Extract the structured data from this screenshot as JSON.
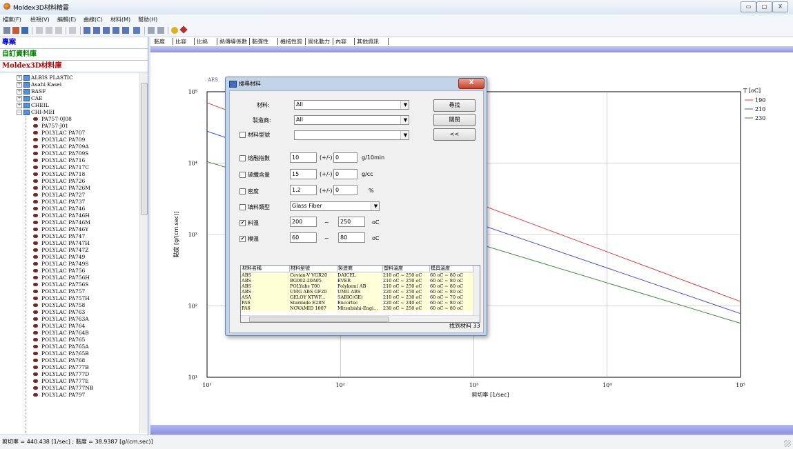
{
  "window": {
    "title": "Moldex3D材料精靈",
    "min": "▭",
    "max": "□",
    "close": "X"
  },
  "menu": [
    "檔案(F)",
    "檢視(V)",
    "編輯(E)",
    "曲線(C)",
    "材料(M)",
    "幫助(H)"
  ],
  "left_panel": {
    "headers": [
      "專案",
      "自訂資料庫",
      "Moldex3D材料庫"
    ],
    "header_colors": [
      "#0000c8",
      "#008000",
      "#c00000"
    ],
    "vendors": [
      "ALBIS PLASTIC",
      "Asahi Kasei",
      "BASF",
      "CAE",
      "CHEIL",
      "CHI-MEI"
    ],
    "materials": [
      "PA757-0J08",
      "PA757-J01",
      "POLYLAC PA707",
      "POLYLAC PA709",
      "POLYLAC PA709A",
      "POLYLAC PA709S",
      "POLYLAC PA716",
      "POLYLAC PA717C",
      "POLYLAC PA718",
      "POLYLAC PA726",
      "POLYLAC PA726M",
      "POLYLAC PA727",
      "POLYLAC PA737",
      "POLYLAC PA746",
      "POLYLAC PA746H",
      "POLYLAC PA746M",
      "POLYLAC PA746Y",
      "POLYLAC PA747",
      "POLYLAC PA747H",
      "POLYLAC PA747Z",
      "POLYLAC PA749",
      "POLYLAC PA749S",
      "POLYLAC PA756",
      "POLYLAC PA756H",
      "POLYLAC PA756S",
      "POLYLAC PA757",
      "POLYLAC PA757H",
      "POLYLAC PA758",
      "POLYLAC PA763",
      "POLYLAC PA763A",
      "POLYLAC PA764",
      "POLYLAC PA764B",
      "POLYLAC PA765",
      "POLYLAC PA765A",
      "POLYLAC PA765B",
      "POLYLAC PA768",
      "POLYLAC PA777B",
      "POLYLAC PA777D",
      "POLYLAC PA777E",
      "POLYLAC PA777NB",
      "POLYLAC PA797"
    ]
  },
  "tabs": [
    "黏度",
    "比容",
    "比熱",
    "熱傳導係數",
    "黏彈性",
    "機械性質",
    "固化動力",
    "內容",
    "其他資訊"
  ],
  "status_bar": "剪切率 = 440.438 [1/sec] ; 黏度 = 38.9387 [g/(cm.sec)]",
  "chart": {
    "hidden_label": "AES",
    "ylabel": "黏度 [g/(cm.sec)]",
    "xlabel": "剪切率 [1/sec]",
    "x_ticks": [
      "10¹",
      "10²",
      "10³",
      "10⁴",
      "10⁵"
    ],
    "y_ticks": [
      "10¹",
      "10²",
      "10³",
      "10⁴",
      "10⁵"
    ],
    "legend_title": "T [oC]"
  },
  "chart_data": {
    "type": "line",
    "x_scale": "log",
    "y_scale": "log",
    "xlim": [
      10,
      100000
    ],
    "ylim": [
      10,
      100000
    ],
    "xlabel": "剪切率 [1/sec]",
    "ylabel": "黏度 [g/(cm.sec)]",
    "legend_title": "T [oC]",
    "series": [
      {
        "name": "190",
        "color": "#d04040",
        "points": [
          [
            10,
            70000
          ],
          [
            100000,
            115
          ]
        ]
      },
      {
        "name": "210",
        "color": "#4050d0",
        "points": [
          [
            10,
            28000
          ],
          [
            100000,
            78
          ]
        ]
      },
      {
        "name": "230",
        "color": "#3a8a3a",
        "points": [
          [
            10,
            10500
          ],
          [
            100000,
            57
          ]
        ]
      }
    ]
  },
  "dialog": {
    "title": "搜尋材料",
    "close": "X",
    "fields": {
      "material_label": "材料:",
      "material_value": "All",
      "vendor_label": "製造商:",
      "vendor_value": "All",
      "grade_label": "材料型號",
      "grade_value": "",
      "melt_label": "熔融指數",
      "melt_value": "10",
      "melt_tol": "0",
      "melt_unit": "g/10min",
      "fiber_label": "玻纖含量",
      "fiber_value": "15",
      "fiber_tol": "0",
      "fiber_unit": "g/cc",
      "density_label": "密度",
      "density_value": "1.2",
      "density_tol": "0",
      "density_unit": "%",
      "filler_label": "填料類型",
      "filler_value": "Glass Fiber",
      "melt_temp_label": "料溫",
      "melt_temp_from": "200",
      "melt_temp_to": "250",
      "melt_temp_unit": "oC",
      "mold_temp_label": "模溫",
      "mold_temp_from": "60",
      "mold_temp_to": "80",
      "mold_temp_unit": "oC",
      "pm": "(+/-)",
      "dash": "~"
    },
    "checks": {
      "grade": false,
      "melt": false,
      "fiber": false,
      "density": false,
      "filler": false,
      "melt_temp": true,
      "mold_temp": true
    },
    "buttons": {
      "search": "尋找",
      "close": "關閉",
      "less": "<<"
    },
    "table": {
      "headers": [
        "材料名稱",
        "材料型號",
        "製造商",
        "塑料溫度",
        "模具溫度"
      ],
      "rows": [
        [
          "ABS",
          "Cevian-V VGR20",
          "DAICEL",
          "210 oC ~ 250 oC",
          "60 oC ~ 80 oC"
        ],
        [
          "ABS",
          "BG002-20A05",
          "EVER",
          "210 oC ~ 250 oC",
          "60 oC ~ 80 oC"
        ],
        [
          "ABS",
          "POLYabs T00",
          "Polykemi AB",
          "210 oC ~ 250 oC",
          "60 oC ~ 80 oC"
        ],
        [
          "ABS",
          "UMG ABS GF20",
          "UMG ABS",
          "220 oC ~ 250 oC",
          "60 oC ~ 80 oC"
        ],
        [
          "ASA",
          "GELOY XTWF...",
          "SABIC(GE)",
          "210 oC ~ 230 oC",
          "60 oC ~ 70 oC"
        ],
        [
          "PA6",
          "Starmide E28N",
          "Encortec",
          "220 oC ~ 240 oC",
          "60 oC ~ 80 oC"
        ],
        [
          "PA6",
          "NOVAMID 1007",
          "Mitsubishi-Engi...",
          "230 oC ~ 250 oC",
          "60 oC ~ 80 oC"
        ]
      ]
    },
    "found": "找到材料 33"
  }
}
